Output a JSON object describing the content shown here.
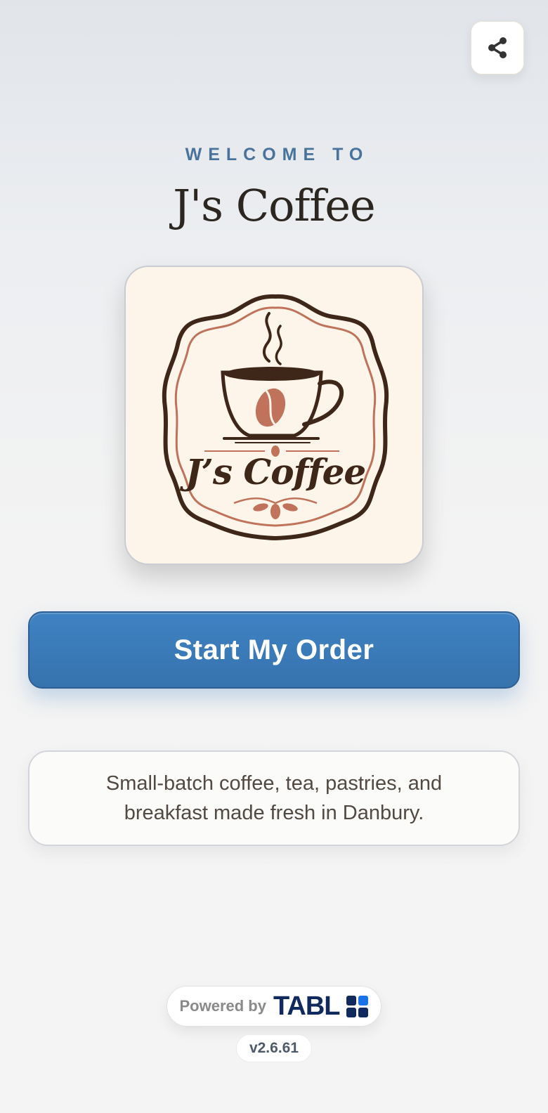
{
  "header": {
    "share_icon": "share-icon"
  },
  "hero": {
    "welcome_label": "WELCOME TO",
    "store_name": "J's Coffee",
    "logo_text": "J’s Coffee"
  },
  "actions": {
    "start_order_label": "Start My Order"
  },
  "about": {
    "description": "Small-batch coffee, tea, pastries, and breakfast made fresh in Danbury."
  },
  "footer": {
    "powered_by_label": "Powered by",
    "brand_name": "TABL",
    "version": "v2.6.61"
  },
  "colors": {
    "accent": "#3f82c3",
    "welcome": "#4a739c",
    "coffee_dark": "#3e2618",
    "coffee_accent": "#c0735a"
  }
}
